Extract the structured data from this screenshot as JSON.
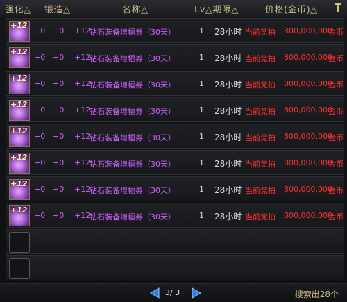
{
  "header": {
    "col_enhance": "强化△",
    "col_forge": "锻造△",
    "col_name": "名称△",
    "col_lv_duration": "Lv△期限△",
    "col_price": "价格(金币)△"
  },
  "items": [
    {
      "enhance": "+0",
      "forge": "+0",
      "amp": "+12",
      "name": "钻石装备增幅券（30天）",
      "lv": "1",
      "duration": "28小时",
      "status": "当前竞拍",
      "price": "800,000,000",
      "currency": "金币"
    },
    {
      "enhance": "+0",
      "forge": "+0",
      "amp": "+12",
      "name": "钻石装备增幅券（30天）",
      "lv": "1",
      "duration": "28小时",
      "status": "当前竞拍",
      "price": "800,000,000",
      "currency": "金币"
    },
    {
      "enhance": "+0",
      "forge": "+0",
      "amp": "+12",
      "name": "钻石装备增幅券（30天）",
      "lv": "1",
      "duration": "28小时",
      "status": "当前竞拍",
      "price": "800,000,000",
      "currency": "金币"
    },
    {
      "enhance": "+0",
      "forge": "+0",
      "amp": "+12",
      "name": "钻石装备增幅券（30天）",
      "lv": "1",
      "duration": "28小时",
      "status": "当前竞拍",
      "price": "800,000,000",
      "currency": "金币"
    },
    {
      "enhance": "+0",
      "forge": "+0",
      "amp": "+12",
      "name": "钻石装备增幅券（30天）",
      "lv": "1",
      "duration": "28小时",
      "status": "当前竞拍",
      "price": "800,000,000",
      "currency": "金币"
    },
    {
      "enhance": "+0",
      "forge": "+0",
      "amp": "+12",
      "name": "钻石装备增幅券（30天）",
      "lv": "1",
      "duration": "28小时",
      "status": "当前竞拍",
      "price": "800,000,000",
      "currency": "金币"
    },
    {
      "enhance": "+0",
      "forge": "+0",
      "amp": "+12",
      "name": "钻石装备增幅券（30天）",
      "lv": "1",
      "duration": "28小时",
      "status": "当前竞拍",
      "price": "800,000,000",
      "currency": "金币"
    },
    {
      "enhance": "+0",
      "forge": "+0",
      "amp": "+12",
      "name": "钻石装备增幅券（30天）",
      "lv": "1",
      "duration": "28小时",
      "status": "当前竞拍",
      "price": "800,000,000",
      "currency": "金币"
    }
  ],
  "item_icon_label": "+12",
  "empty_rows": 2,
  "pager": {
    "text": "3/ 3"
  },
  "search_count": "搜索出28个",
  "colors": {
    "name": "#d060ff",
    "bid": "#ff3030",
    "header": "#cdb98a",
    "arrow": "#2f7fe0"
  }
}
